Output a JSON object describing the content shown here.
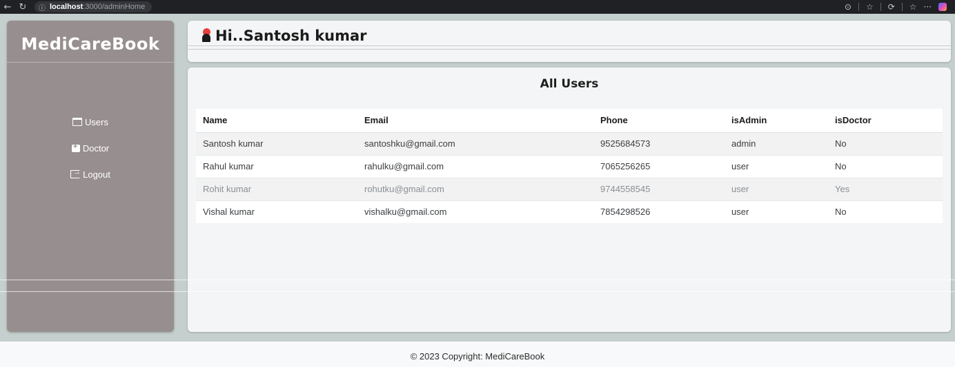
{
  "browser": {
    "url_host": "localhost",
    "url_path": ":3000/adminHome",
    "back_glyph": "←",
    "refresh_glyph": "↻",
    "info_glyph": "ⓘ",
    "icons": [
      "reader-mode-icon",
      "favorite-icon",
      "extensions-icon",
      "favorites-bar-icon",
      "more-menu-icon",
      "copilot-icon"
    ]
  },
  "sidebar": {
    "logo": "MediCareBook",
    "items": [
      {
        "label": "Users",
        "icon": "calendar-icon"
      },
      {
        "label": "Doctor",
        "icon": "doctor-bag-icon"
      },
      {
        "label": "Logout",
        "icon": "logout-icon"
      }
    ]
  },
  "header": {
    "greeting": "Hi..Santosh kumar",
    "icon": "bell-icon"
  },
  "main": {
    "title": "All Users",
    "columns": [
      "Name",
      "Email",
      "Phone",
      "isAdmin",
      "isDoctor"
    ],
    "rows": [
      [
        "Santosh kumar",
        "santoshku@gmail.com",
        "9525684573",
        "admin",
        "No"
      ],
      [
        "Rahul kumar",
        "rahulku@gmail.com",
        "7065256265",
        "user",
        "No"
      ],
      [
        "Rohit kumar",
        "rohutku@gmail.com",
        "9744558545",
        "user",
        "Yes"
      ],
      [
        "Vishal kumar",
        "vishalku@gmail.com",
        "7854298526",
        "user",
        "No"
      ]
    ]
  },
  "footer": {
    "copyright": "© 2023 Copyright: MediCareBook"
  },
  "colors": {
    "sidebar_bg": "#978f8f",
    "page_bg": "#c5cfcd",
    "bell_red": "#e8413c"
  }
}
